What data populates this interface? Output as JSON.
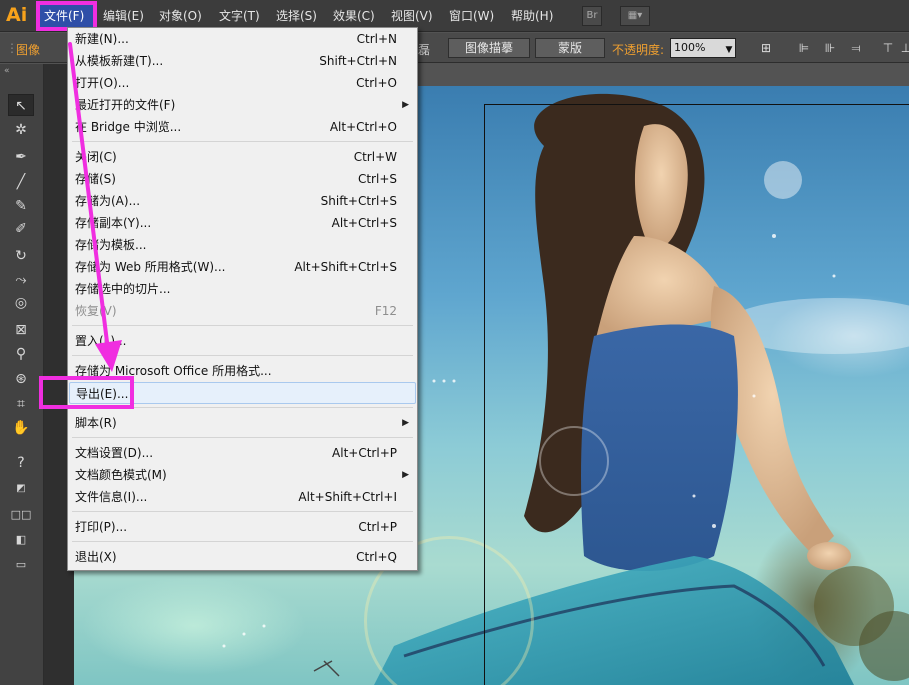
{
  "app": {
    "logo": "Ai"
  },
  "menubar": {
    "items": [
      "文件(F)",
      "编辑(E)",
      "对象(O)",
      "文字(T)",
      "选择(S)",
      "效果(C)",
      "视图(V)",
      "窗口(W)",
      "帮助(H)"
    ],
    "bridge_btn": "Br"
  },
  "controlbar": {
    "image_label": "图像",
    "crop_label": "磊",
    "trace_btn": "图像描摹",
    "mask_btn": "蒙版",
    "opacity_label": "不透明度:",
    "opacity_value": "100%"
  },
  "file_menu": {
    "groups": [
      [
        {
          "label": "新建(N)...",
          "shortcut": "Ctrl+N"
        },
        {
          "label": "从模板新建(T)...",
          "shortcut": "Shift+Ctrl+N"
        },
        {
          "label": "打开(O)...",
          "shortcut": "Ctrl+O"
        },
        {
          "label": "最近打开的文件(F)",
          "shortcut": "",
          "submenu": true
        },
        {
          "label": "在 Bridge 中浏览...",
          "shortcut": "Alt+Ctrl+O"
        }
      ],
      [
        {
          "label": "关闭(C)",
          "shortcut": "Ctrl+W"
        },
        {
          "label": "存储(S)",
          "shortcut": "Ctrl+S"
        },
        {
          "label": "存储为(A)...",
          "shortcut": "Shift+Ctrl+S"
        },
        {
          "label": "存储副本(Y)...",
          "shortcut": "Alt+Ctrl+S"
        },
        {
          "label": "存储为模板...",
          "shortcut": ""
        },
        {
          "label": "存储为 Web 所用格式(W)...",
          "shortcut": "Alt+Shift+Ctrl+S"
        },
        {
          "label": "存储选中的切片...",
          "shortcut": ""
        },
        {
          "label": "恢复(V)",
          "shortcut": "F12",
          "disabled": true
        }
      ],
      [
        {
          "label": "置入(L)...",
          "shortcut": ""
        }
      ],
      [
        {
          "label": "存储为 Microsoft Office 所用格式...",
          "shortcut": ""
        },
        {
          "label": "导出(E)...",
          "shortcut": "",
          "highlighted": true
        }
      ],
      [
        {
          "label": "脚本(R)",
          "shortcut": "",
          "submenu": true
        }
      ],
      [
        {
          "label": "文档设置(D)...",
          "shortcut": "Alt+Ctrl+P"
        },
        {
          "label": "文档颜色模式(M)",
          "shortcut": "",
          "submenu": true
        },
        {
          "label": "文件信息(I)...",
          "shortcut": "Alt+Shift+Ctrl+I"
        }
      ],
      [
        {
          "label": "打印(P)...",
          "shortcut": "Ctrl+P"
        }
      ],
      [
        {
          "label": "退出(X)",
          "shortcut": "Ctrl+Q"
        }
      ]
    ]
  },
  "toolbar": {
    "tools": [
      "selection-tool",
      "magic-wand-tool",
      "pen-tool",
      "line-tool",
      "brush-tool",
      "pencil-tool",
      "rotate-tool",
      "width-tool",
      "shape-builder-tool",
      "mesh-tool",
      "eyedropper-tool",
      "symbol-sprayer-tool",
      "artboard-tool",
      "hand-tool",
      "help-tool"
    ]
  },
  "colors": {
    "accent_annotation": "#f02ee0",
    "ai_logo": "#f7a21b"
  }
}
